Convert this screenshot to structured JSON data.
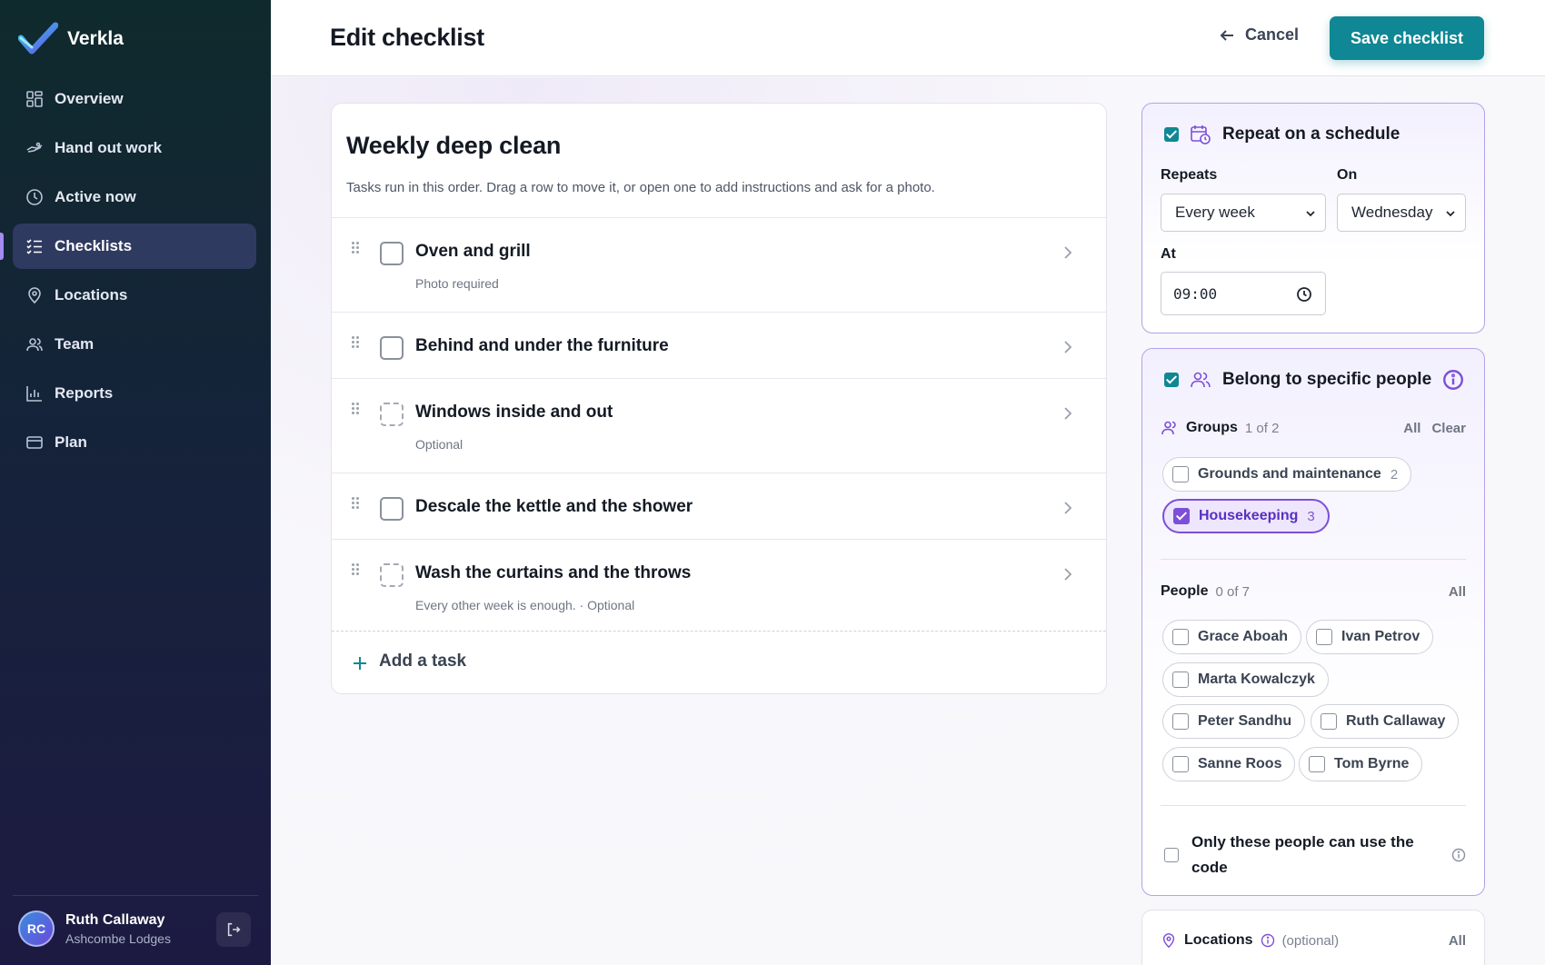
{
  "app": {
    "name": "Verkla"
  },
  "sidebar": {
    "items": [
      {
        "label": "Overview",
        "icon": "grid-icon"
      },
      {
        "label": "Hand out work",
        "icon": "handout-icon"
      },
      {
        "label": "Active now",
        "icon": "clock-icon"
      },
      {
        "label": "Checklists",
        "icon": "checklist-icon",
        "active": true
      },
      {
        "label": "Locations",
        "icon": "location-pin-icon"
      },
      {
        "label": "Team",
        "icon": "team-icon"
      },
      {
        "label": "Reports",
        "icon": "bar-chart-icon"
      },
      {
        "label": "Plan",
        "icon": "card-icon"
      }
    ],
    "user": {
      "initials": "RC",
      "name": "Ruth Callaway",
      "org": "Ashcombe Lodges"
    }
  },
  "header": {
    "title": "Edit checklist",
    "cancel_label": "Cancel",
    "save_label": "Save checklist"
  },
  "checklist": {
    "title": "Weekly deep clean",
    "subtitle": "Tasks run in this order. Drag a row to move it, or open one to add instructions and ask for a photo.",
    "tasks": [
      {
        "title": "Oven and grill",
        "note": "Photo required",
        "optional": false
      },
      {
        "title": "Behind and under the furniture",
        "note": "",
        "optional": false
      },
      {
        "title": "Windows inside and out",
        "note": "Optional",
        "optional": true
      },
      {
        "title": "Descale the kettle and the shower",
        "note": "",
        "optional": false
      },
      {
        "title": "Wash the curtains and the throws",
        "note": "Every other week is enough. · Optional",
        "optional": true
      }
    ],
    "add_task_label": "Add a task"
  },
  "schedule": {
    "enabled": true,
    "title": "Repeat on a schedule",
    "repeats_label": "Repeats",
    "repeats_value": "Every week",
    "on_label": "On",
    "on_value": "Wednesday",
    "at_label": "At",
    "at_value": "09:00"
  },
  "people_panel": {
    "enabled": true,
    "title": "Belong to specific people",
    "groups": {
      "title": "Groups",
      "count": "1 of 2",
      "all_label": "All",
      "clear_label": "Clear",
      "items": [
        {
          "label": "Grounds and maintenance",
          "count": "2",
          "selected": false
        },
        {
          "label": "Housekeeping",
          "count": "3",
          "selected": true
        }
      ]
    },
    "people": {
      "title": "People",
      "count": "0 of 7",
      "all_label": "All",
      "items": [
        {
          "label": "Grace Aboah",
          "selected": false
        },
        {
          "label": "Ivan Petrov",
          "selected": false
        },
        {
          "label": "Marta Kowalczyk",
          "selected": false
        },
        {
          "label": "Peter Sandhu",
          "selected": false
        },
        {
          "label": "Ruth Callaway",
          "selected": false
        },
        {
          "label": "Sanne Roos",
          "selected": false
        },
        {
          "label": "Tom Byrne",
          "selected": false
        }
      ]
    },
    "restrict": {
      "label_line1": "Only these people can use the",
      "label_line2": "code",
      "checked": false
    }
  },
  "locations": {
    "title": "Locations",
    "optional_label": "(optional)",
    "all_label": "All"
  },
  "colors": {
    "accent": "#0f8794",
    "purple": "#7c4fd8",
    "sidebar_active": "#2f3a61"
  }
}
